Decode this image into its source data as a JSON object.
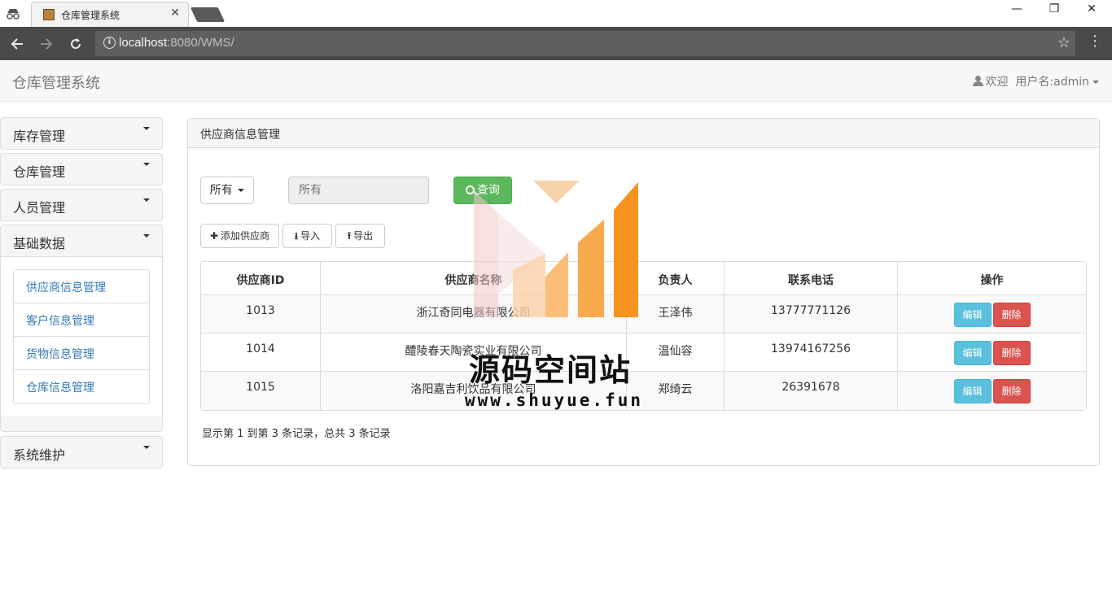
{
  "browser": {
    "tab_title": "仓库管理系统",
    "tab_close": "✕",
    "url_host": "localhost",
    "url_rest": ":8080/WMS/",
    "controls": {
      "minimize": "—",
      "maximize": "❐",
      "close": "✕"
    }
  },
  "navbar": {
    "brand": "仓库管理系统",
    "welcome": "欢迎",
    "user": "用户名:admin"
  },
  "sidebar": {
    "sections": [
      {
        "label": "库存管理"
      },
      {
        "label": "仓库管理"
      },
      {
        "label": "人员管理"
      },
      {
        "label": "基础数据",
        "items": [
          "供应商信息管理",
          "客户信息管理",
          "货物信息管理",
          "仓库信息管理"
        ]
      },
      {
        "label": "系统维护"
      }
    ]
  },
  "main": {
    "panel_title": "供应商信息管理",
    "filter_select": "所有",
    "search_placeholder": "所有",
    "query_label": "查询",
    "actions": {
      "add": "添加供应商",
      "import": "导入",
      "export": "导出"
    },
    "table": {
      "headers": [
        "供应商ID",
        "供应商名称",
        "负责人",
        "联系电话",
        "操作"
      ],
      "rows": [
        {
          "id": "1013",
          "name": "浙江奇同电器有限公司",
          "person": "王泽伟",
          "phone": "13777771126"
        },
        {
          "id": "1014",
          "name": "醴陵春天陶瓷实业有限公司",
          "person": "温仙容",
          "phone": "13974167256"
        },
        {
          "id": "1015",
          "name": "洛阳嘉吉利饮品有限公司",
          "person": "郑绮云",
          "phone": "26391678"
        }
      ],
      "edit_label": "编辑",
      "delete_label": "删除"
    },
    "pager_text": "显示第 1 到第 3 条记录，总共 3 条记录"
  },
  "watermark": {
    "text": "源码空间站",
    "url": "www.shuyue.fun"
  },
  "colors": {
    "success": "#5cb85c",
    "info": "#5bc0de",
    "danger": "#d9534f",
    "link": "#337ab7",
    "watermark_orange": "#f7931e"
  }
}
